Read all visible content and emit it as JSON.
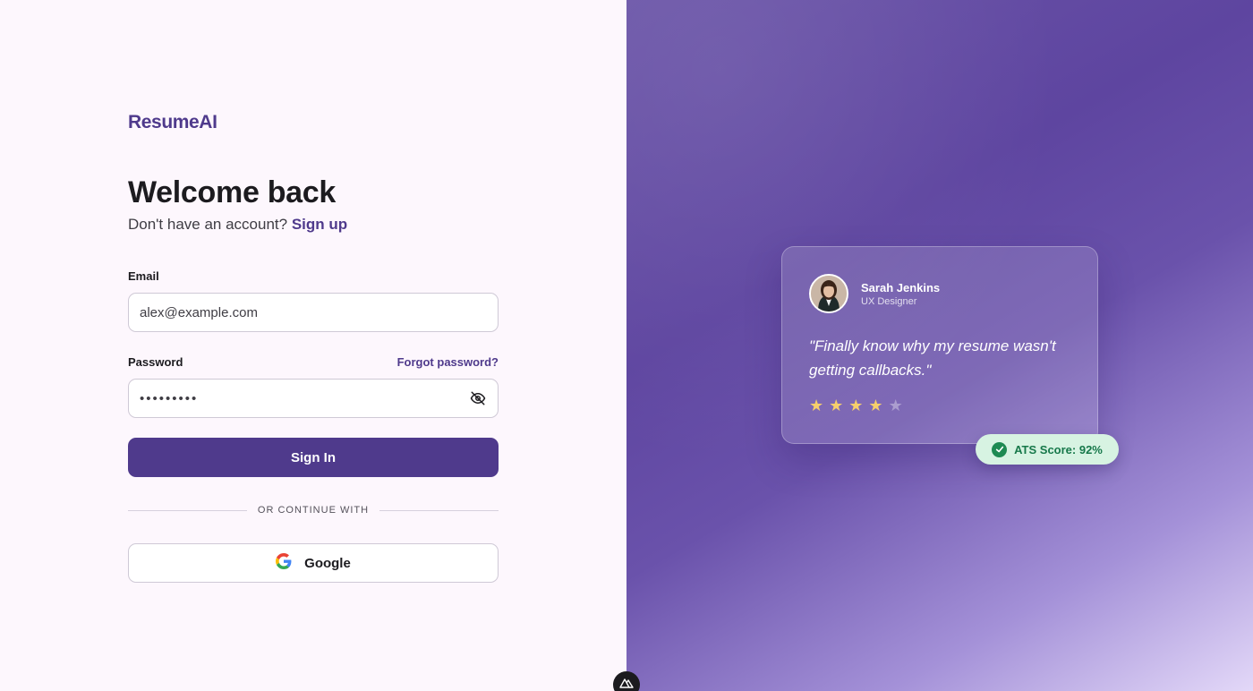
{
  "brand": {
    "logo": "ResumeAI"
  },
  "login": {
    "title": "Welcome back",
    "subtitle_prefix": "Don't have an account?",
    "signup_link": "Sign up",
    "email_label": "Email",
    "email_value": "alex@example.com",
    "password_label": "Password",
    "forgot_link": "Forgot password?",
    "password_masked": "•••••••••",
    "signin_button": "Sign In",
    "divider_text": "OR CONTINUE WITH",
    "google_button": "Google"
  },
  "testimonial": {
    "name": "Sarah Jenkins",
    "role": "UX Designer",
    "quote": "\"Finally know why my resume wasn't getting callbacks.\"",
    "rating": 4,
    "rating_max": 5
  },
  "badge": {
    "text": "ATS Score: 92%"
  },
  "colors": {
    "accent": "#4f3a8c",
    "left_bg": "#fdf7fd",
    "badge_bg": "#d7f3e2",
    "badge_text": "#16784a",
    "star": "#f6cf6b"
  },
  "icons": {
    "eye_toggle": "eye-off-icon",
    "google": "google-logo-icon",
    "badge": "check-circle-icon",
    "devtools": "nuxt-devtools-icon"
  }
}
